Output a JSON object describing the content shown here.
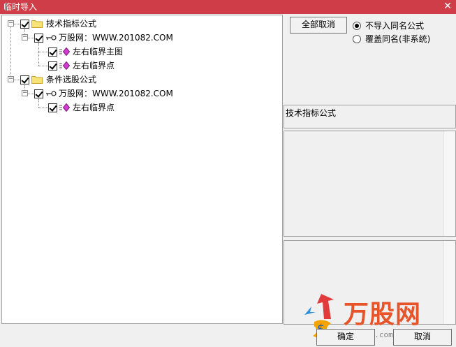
{
  "window": {
    "title": "临时导入",
    "close": "✕"
  },
  "tree": {
    "root1": {
      "label": "技术指标公式",
      "expander": "−"
    },
    "root1_child": {
      "label": "万股网：WWW.201082.COM",
      "expander": "−"
    },
    "root1_leaf1": {
      "label": "左右临界主图"
    },
    "root1_leaf2": {
      "label": "左右临界点"
    },
    "root2": {
      "label": "条件选股公式",
      "expander": "−"
    },
    "root2_child": {
      "label": "万股网：WWW.201082.COM",
      "expander": "−"
    },
    "root2_leaf1": {
      "label": "左右临界点"
    }
  },
  "right": {
    "clear_all": "全部取消",
    "radio_skip": "不导入同名公式",
    "radio_overwrite": "覆盖同名(非系统)",
    "category_label": "技术指标公式"
  },
  "watermark": {
    "brand": "万股网",
    "url": "www.201082.com"
  },
  "buttons": {
    "ok": "确定",
    "cancel": "取消"
  }
}
